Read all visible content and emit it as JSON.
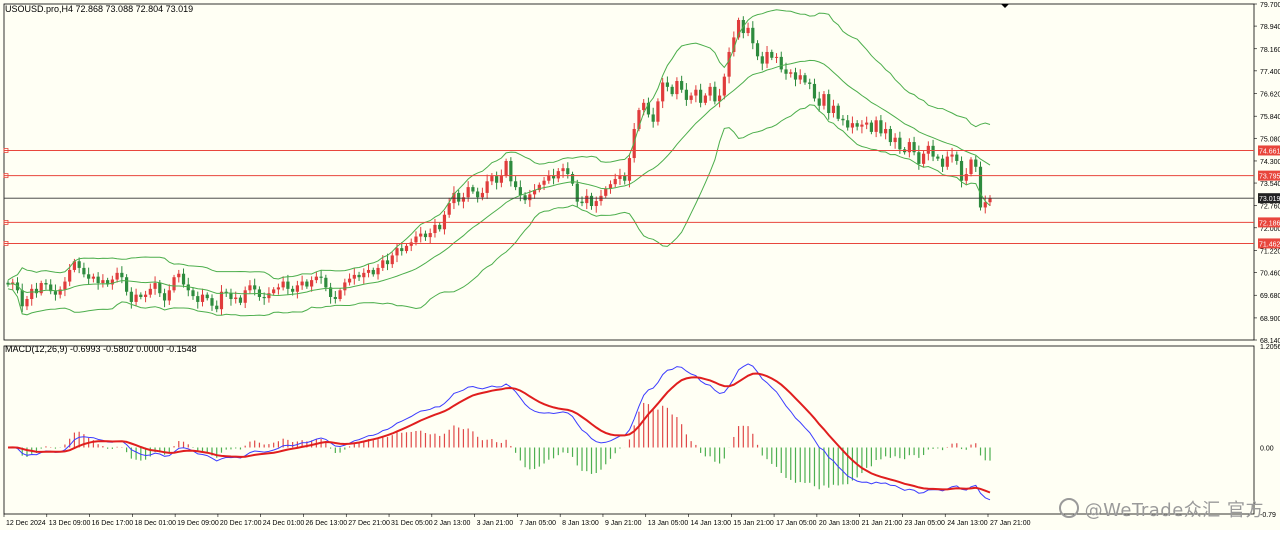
{
  "window": {
    "title_text": "USOUSD.pro,H4  72.868 73.088 72.804 73.019"
  },
  "macd_panel": {
    "title_text": "MACD(12,26,9) -0.6993 -0.5802 0.0000 -0.1548",
    "axis_labels": [
      "1.2056",
      "0.00",
      "-0.79"
    ]
  },
  "watermark": {
    "text": "@WeTrade众汇 官方"
  },
  "colors": {
    "background": "#fffff4",
    "bull_candle": "#e03c3c",
    "bear_candle": "#2e8b3e",
    "bollinger": "#4cae4c",
    "level_line": "#e8463c",
    "price_line": "#333333",
    "macd_main": "#3c3cff",
    "macd_signal": "#e01e1e",
    "hist_up": "#e04848",
    "hist_down": "#4caf50"
  },
  "chart_data": [
    {
      "type": "candlestick",
      "symbol": "USOUSD.pro",
      "timeframe": "H4",
      "ohlc_header": {
        "open": 72.868,
        "high": 73.088,
        "low": 72.804,
        "close": 73.019
      },
      "ylim": [
        68.14,
        79.7
      ],
      "y_tick_labels": [
        "79.700",
        "78.940",
        "78.160",
        "77.400",
        "76.620",
        "75.840",
        "75.080",
        "74.300",
        "73.540",
        "72.760",
        "72.000",
        "71.220",
        "70.460",
        "69.680",
        "68.900",
        "68.140"
      ],
      "x_tick_labels": [
        "12 Dec 2024",
        "13 Dec 09:00",
        "16 Dec 17:00",
        "18 Dec 01:00",
        "19 Dec 09:00",
        "20 Dec 17:00",
        "24 Dec 01:00",
        "26 Dec 13:00",
        "27 Dec 21:00",
        "31 Dec 05:00",
        "2 Jan 13:00",
        "3 Jan 21:00",
        "7 Jan 05:00",
        "8 Jan 13:00",
        "9 Jan 21:00",
        "13 Jan 05:00",
        "14 Jan 13:00",
        "15 Jan 21:00",
        "17 Jan 05:00",
        "20 Jan 13:00",
        "21 Jan 21:00",
        "23 Jan 05:00",
        "24 Jan 13:00",
        "27 Jan 21:00"
      ],
      "current_price": 73.019,
      "horizontal_levels": [
        74.661,
        73.795,
        72.186,
        71.462
      ],
      "closes": [
        70.05,
        70.12,
        69.85,
        69.3,
        69.55,
        69.9,
        69.75,
        70.1,
        70.05,
        69.82,
        69.7,
        69.88,
        70.15,
        70.55,
        70.85,
        70.62,
        70.4,
        70.25,
        70.32,
        70.1,
        70.2,
        70.05,
        70.22,
        70.45,
        70.3,
        69.8,
        69.45,
        69.7,
        69.62,
        69.7,
        69.9,
        70.1,
        69.75,
        69.5,
        69.85,
        70.3,
        70.42,
        70.05,
        69.85,
        69.65,
        69.45,
        69.7,
        69.58,
        69.32,
        69.2,
        69.8,
        69.75,
        69.55,
        69.6,
        69.42,
        69.85,
        70.02,
        69.88,
        69.62,
        69.58,
        69.75,
        69.88,
        69.95,
        70.15,
        69.9,
        69.8,
        70.02,
        70.15,
        69.98,
        70.2,
        70.32,
        70.28,
        69.95,
        69.62,
        69.55,
        69.85,
        70.12,
        70.25,
        70.38,
        70.3,
        70.45,
        70.55,
        70.4,
        70.62,
        70.88,
        70.75,
        71.05,
        71.3,
        71.2,
        71.38,
        71.5,
        71.7,
        71.8,
        71.68,
        71.82,
        72.1,
        71.95,
        72.45,
        72.85,
        73.2,
        72.9,
        73.05,
        73.4,
        73.25,
        73.05,
        73.2,
        73.6,
        73.78,
        73.55,
        73.8,
        74.3,
        73.6,
        73.4,
        73.12,
        72.95,
        73.15,
        73.3,
        73.48,
        73.62,
        73.8,
        73.7,
        73.95,
        74.05,
        73.85,
        73.52,
        72.9,
        72.85,
        73.1,
        72.75,
        72.92,
        73.1,
        73.35,
        73.5,
        73.68,
        73.8,
        73.62,
        74.4,
        75.4,
        76.05,
        76.3,
        75.9,
        75.65,
        76.35,
        77.0,
        76.85,
        76.6,
        77.05,
        76.75,
        76.4,
        76.55,
        76.75,
        76.3,
        76.55,
        76.85,
        76.35,
        76.55,
        77.2,
        78.05,
        78.55,
        79.15,
        78.7,
        78.88,
        78.35,
        77.9,
        77.65,
        78.05,
        77.85,
        77.88,
        77.45,
        77.3,
        77.35,
        77.1,
        77.25,
        77.0,
        76.95,
        76.45,
        76.2,
        76.6,
        75.95,
        76.2,
        75.75,
        75.7,
        75.45,
        75.6,
        75.48,
        75.55,
        75.62,
        75.3,
        75.7,
        75.25,
        75.4,
        74.95,
        75.1,
        74.7,
        74.6,
        74.95,
        74.6,
        74.2,
        74.55,
        74.82,
        74.45,
        74.38,
        74.1,
        74.45,
        74.52,
        74.3,
        73.62,
        73.85,
        74.35,
        74.1,
        72.7,
        72.88,
        73.019
      ],
      "bollinger": {
        "period": 20,
        "deviations": 2
      }
    },
    {
      "type": "bar",
      "indicator": "MACD",
      "params": [
        12,
        26,
        9
      ],
      "main": -0.6993,
      "signal": -0.5802,
      "ylim": [
        -0.79,
        1.2056
      ],
      "y_tick_labels": [
        "1.2056",
        "0.00",
        "-0.79"
      ],
      "series": [
        {
          "name": "MACD",
          "style": "histogram"
        },
        {
          "name": "Signal",
          "style": "line"
        }
      ]
    }
  ]
}
